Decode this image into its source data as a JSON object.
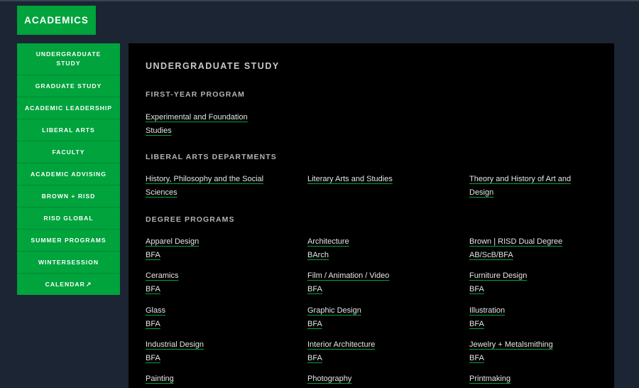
{
  "header": {
    "academics_label": "ACADEMICS"
  },
  "sidebar": {
    "items": [
      {
        "label": "UNDERGRADUATE STUDY"
      },
      {
        "label": "GRADUATE STUDY"
      },
      {
        "label": "ACADEMIC LEADERSHIP"
      },
      {
        "label": "LIBERAL ARTS"
      },
      {
        "label": "FACULTY"
      },
      {
        "label": "ACADEMIC ADVISING"
      },
      {
        "label": "BROWN + RISD"
      },
      {
        "label": "RISD GLOBAL"
      },
      {
        "label": "SUMMER PROGRAMS"
      },
      {
        "label": "WINTERSESSION"
      },
      {
        "label": "CALENDAR",
        "icon": "external-arrow-icon",
        "glyph": "↗"
      }
    ]
  },
  "main": {
    "title": "UNDERGRADUATE STUDY",
    "first_year": {
      "title": "FIRST-YEAR PROGRAM",
      "links": [
        {
          "label": "Experimental and Foundation Studies"
        }
      ]
    },
    "liberal_arts": {
      "title": "LIBERAL ARTS DEPARTMENTS",
      "links": [
        {
          "label": "History, Philosophy and the Social Sciences"
        },
        {
          "label": "Literary Arts and Studies"
        },
        {
          "label": "Theory and History of Art and Design"
        }
      ]
    },
    "degrees": {
      "title": "DEGREE PROGRAMS",
      "programs": [
        {
          "name": "Apparel Design",
          "degree": "BFA"
        },
        {
          "name": "Architecture",
          "degree": "BArch"
        },
        {
          "name": "Brown | RISD Dual Degree",
          "degree": "AB/ScB/BFA"
        },
        {
          "name": "Ceramics",
          "degree": "BFA"
        },
        {
          "name": "Film / Animation / Video",
          "degree": "BFA"
        },
        {
          "name": "Furniture Design",
          "degree": "BFA"
        },
        {
          "name": "Glass",
          "degree": "BFA"
        },
        {
          "name": "Graphic Design",
          "degree": "BFA"
        },
        {
          "name": "Illustration",
          "degree": "BFA"
        },
        {
          "name": "Industrial Design",
          "degree": "BFA"
        },
        {
          "name": "Interior Architecture",
          "degree": "BFA"
        },
        {
          "name": "Jewelry + Metalsmithing",
          "degree": "BFA"
        },
        {
          "name": "Painting",
          "degree": ""
        },
        {
          "name": "Photography",
          "degree": ""
        },
        {
          "name": "Printmaking",
          "degree": ""
        }
      ]
    }
  },
  "colors": {
    "accent": "#00a33c",
    "page_bg": "#1b2533",
    "panel_bg": "#000000"
  }
}
